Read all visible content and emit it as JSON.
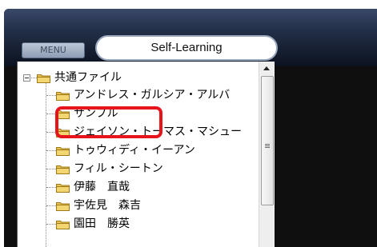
{
  "window": {
    "menu_label": "MENU",
    "title": "Self-Learning",
    "accent_color": "#e8141c"
  },
  "tree": {
    "root": {
      "label": "共通ファイル",
      "icon": "folder-icon",
      "expanded": true
    },
    "items": [
      {
        "label": "アンドレス・ガルシア・アルバ",
        "icon": "folder-icon"
      },
      {
        "label": "サンプル",
        "icon": "folder-icon",
        "highlighted": true
      },
      {
        "label": "ジェイソン・トーマス・マシュー",
        "icon": "folder-icon"
      },
      {
        "label": "トゥウィディ・イーアン",
        "icon": "folder-icon"
      },
      {
        "label": "フィル・シートン",
        "icon": "folder-icon"
      },
      {
        "label": "伊藤　直哉",
        "icon": "folder-icon"
      },
      {
        "label": "宇佐見　森吉",
        "icon": "folder-icon"
      },
      {
        "label": "園田　勝英",
        "icon": "folder-icon"
      }
    ]
  }
}
